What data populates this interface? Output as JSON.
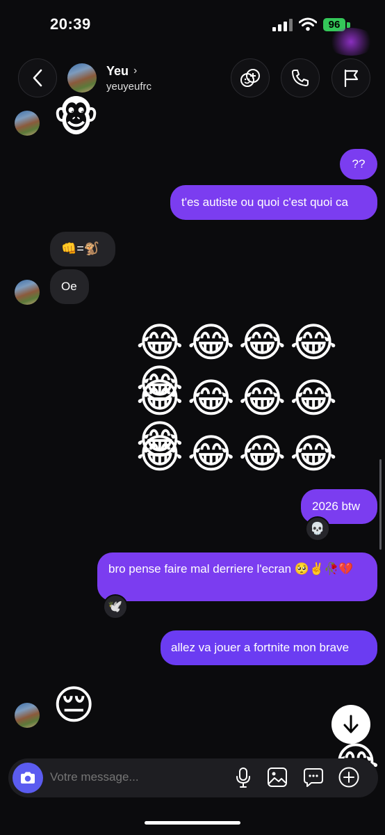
{
  "status_bar": {
    "time": "20:39",
    "battery": "96"
  },
  "header": {
    "name": "Yeu",
    "username": "yeuyeufrc"
  },
  "messages": {
    "m1_emoji": "🐵",
    "m2": "??",
    "m3": "t'es autiste ou quoi c'est quoi ca",
    "m4": "👊=🐒",
    "m5": "Oe",
    "laugh_row1": "😂😂😂😂😂",
    "laugh_row2": "😂😂😂😂😂",
    "laugh_row3": "😂😂😂😂",
    "m6": "2026 btw",
    "m6_reaction": "💀",
    "m7": "bro pense faire mal derriere l'ecran 🥺✌️🥀💔",
    "m7_reaction": "🕊️",
    "m8": "allez va jouer a fortnite mon brave",
    "m9_emoji": "😔",
    "partial_emoji": "😂"
  },
  "composer": {
    "placeholder": "Votre message..."
  },
  "colors": {
    "my_bubble": "#7b3df0",
    "their_bubble": "#242428",
    "camera": "#5b5cf0"
  }
}
